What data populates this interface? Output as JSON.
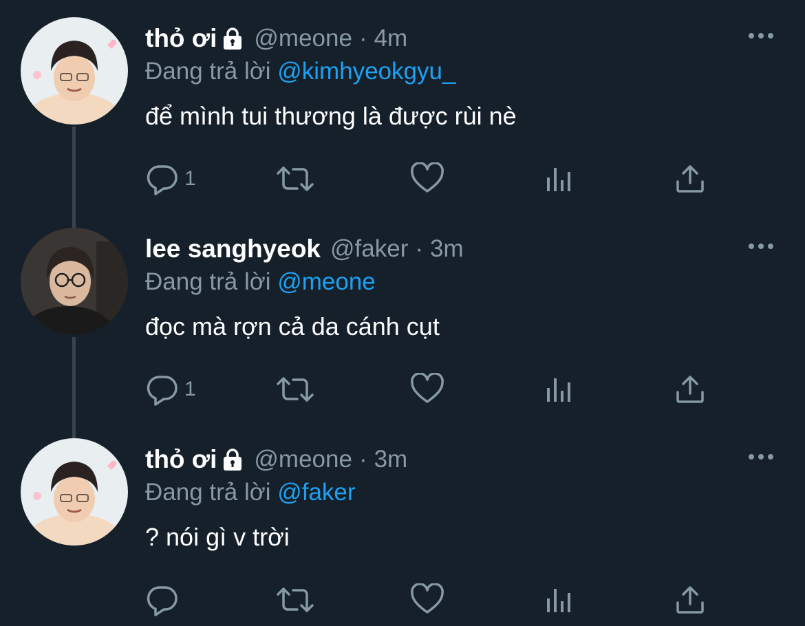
{
  "colors": {
    "background": "#15202b",
    "text_primary": "#ffffff",
    "text_secondary": "#8899a6",
    "link": "#1da1f2",
    "thread_line": "#38444d"
  },
  "tweets": [
    {
      "display_name": "thỏ ơi",
      "protected": true,
      "handle": "@meone",
      "separator": "·",
      "time": "4m",
      "reply_prefix": "Đang trả lời ",
      "reply_to": "@kimhyeokgyu_",
      "text": "để mình tui thương là được rùi nè",
      "reply_count": "1",
      "icons": [
        "avatar",
        "lock-icon",
        "more-icon",
        "reply-icon",
        "retweet-icon",
        "like-icon",
        "stats-icon",
        "share-icon"
      ]
    },
    {
      "display_name": "lee sanghyeok",
      "protected": false,
      "handle": "@faker",
      "separator": "·",
      "time": "3m",
      "reply_prefix": "Đang trả lời ",
      "reply_to": "@meone",
      "text": "đọc mà rợn cả da cánh cụt",
      "reply_count": "1",
      "icons": [
        "avatar",
        "more-icon",
        "reply-icon",
        "retweet-icon",
        "like-icon",
        "stats-icon",
        "share-icon"
      ]
    },
    {
      "display_name": "thỏ ơi",
      "protected": true,
      "handle": "@meone",
      "separator": "·",
      "time": "3m",
      "reply_prefix": "Đang trả lời ",
      "reply_to": "@faker",
      "text": "? nói gì v trời",
      "reply_count": "",
      "icons": [
        "avatar",
        "lock-icon",
        "more-icon",
        "reply-icon",
        "retweet-icon",
        "like-icon",
        "stats-icon",
        "share-icon"
      ]
    }
  ]
}
